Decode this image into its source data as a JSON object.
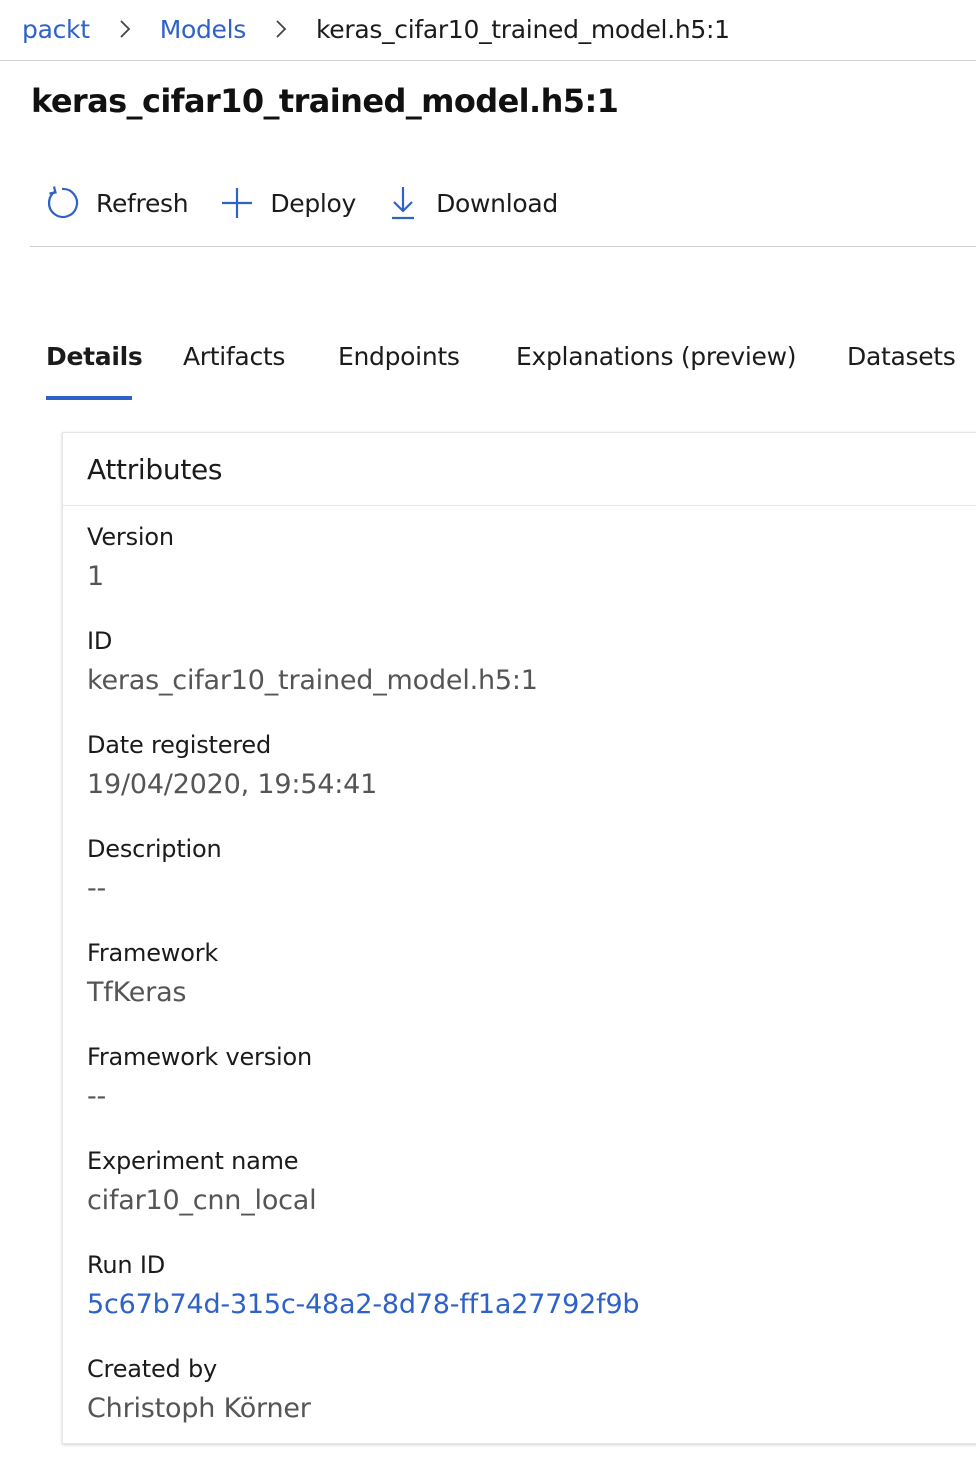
{
  "breadcrumb": {
    "items": [
      {
        "label": "packt"
      },
      {
        "label": "Models"
      },
      {
        "label": "keras_cifar10_trained_model.h5:1"
      }
    ]
  },
  "page": {
    "title": "keras_cifar10_trained_model.h5:1"
  },
  "toolbar": {
    "refresh_label": "Refresh",
    "deploy_label": "Deploy",
    "download_label": "Download"
  },
  "tabs": [
    {
      "label": "Details",
      "active": true
    },
    {
      "label": "Artifacts"
    },
    {
      "label": "Endpoints"
    },
    {
      "label": "Explanations (preview)"
    },
    {
      "label": "Datasets"
    }
  ],
  "attributes": {
    "title": "Attributes",
    "items": [
      {
        "label": "Version",
        "value": "1"
      },
      {
        "label": "ID",
        "value": "keras_cifar10_trained_model.h5:1"
      },
      {
        "label": "Date registered",
        "value": "19/04/2020, 19:54:41"
      },
      {
        "label": "Description",
        "value": "--"
      },
      {
        "label": "Framework",
        "value": "TfKeras"
      },
      {
        "label": "Framework version",
        "value": "--"
      },
      {
        "label": "Experiment name",
        "value": "cifar10_cnn_local"
      },
      {
        "label": "Run ID",
        "value": "5c67b74d-315c-48a2-8d78-ff1a27792f9b"
      },
      {
        "label": "Created by",
        "value": "Christoph Körner"
      }
    ]
  },
  "colors": {
    "accent": "#2f62c8",
    "text": "#1b1b1b",
    "muted": "#555555"
  },
  "icons": [
    "chevron-right-icon",
    "refresh-icon",
    "plus-icon",
    "download-icon"
  ]
}
